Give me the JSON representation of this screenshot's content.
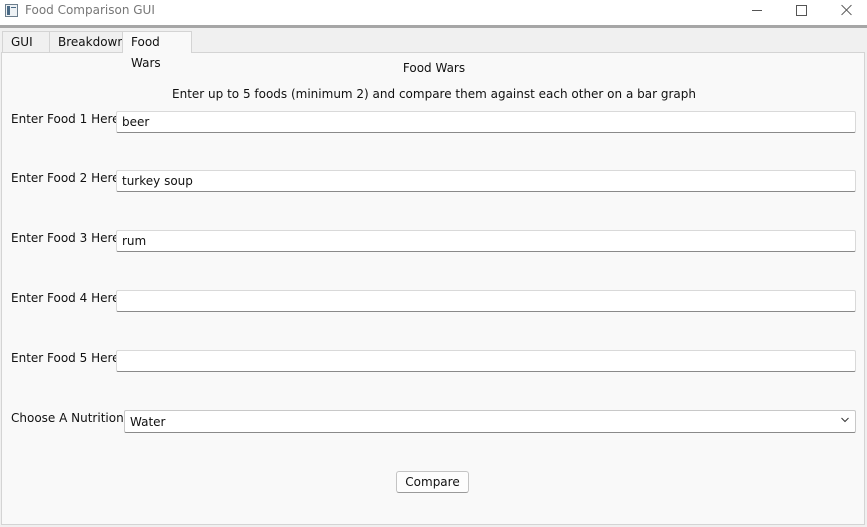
{
  "window": {
    "title": "Food Comparison GUI",
    "app_icon": "window-app-icon",
    "controls": [
      "minimize-icon",
      "maximize-icon",
      "close-icon"
    ]
  },
  "tabs": [
    {
      "label": "GUI",
      "active": false
    },
    {
      "label": "Breakdown",
      "active": false
    },
    {
      "label": "Food Wars",
      "active": true
    }
  ],
  "main": {
    "title": "Food Wars",
    "subtitle": "Enter up to 5 foods (minimum 2) and compare them against each other on a bar graph",
    "foods": [
      {
        "label": "Enter Food 1 Here",
        "value": "beer"
      },
      {
        "label": "Enter Food 2 Here",
        "value": "turkey soup"
      },
      {
        "label": "Enter Food 3 Here",
        "value": "rum"
      },
      {
        "label": "Enter Food 4 Here",
        "value": ""
      },
      {
        "label": "Enter Food 5 Here",
        "value": ""
      }
    ],
    "nutrition": {
      "label": "Choose A Nutrition",
      "selected": "Water"
    },
    "compare_label": "Compare"
  }
}
